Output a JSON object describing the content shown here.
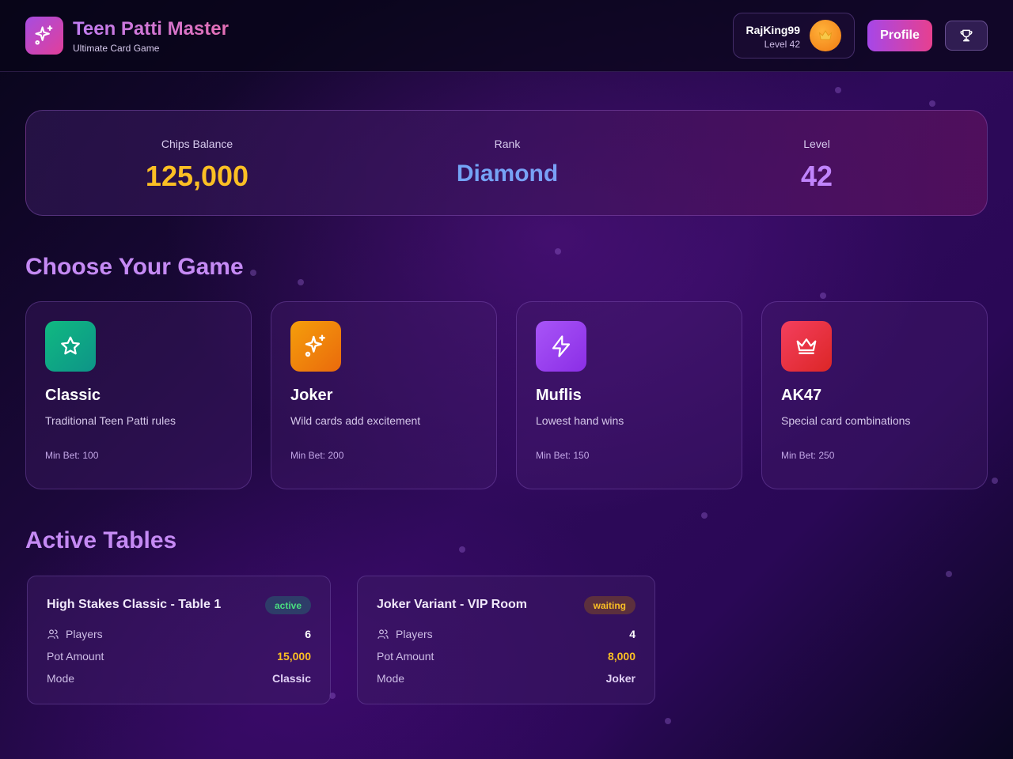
{
  "header": {
    "app_title": "Teen Patti Master",
    "app_subtitle": "Ultimate Card Game",
    "logo_icon": "sparkles-icon",
    "user": {
      "name": "RajKing99",
      "level": "Level 42",
      "avatar_icon": "crown-icon"
    },
    "profile_label": "Profile",
    "trophy_icon": "trophy-icon"
  },
  "stats": {
    "chips": {
      "label": "Chips Balance",
      "value": "125,000"
    },
    "rank": {
      "label": "Rank",
      "value": "Diamond"
    },
    "level": {
      "label": "Level",
      "value": "42"
    }
  },
  "games_section": {
    "title": "Choose Your Game",
    "games": [
      {
        "name": "Classic",
        "description": "Traditional Teen Patti rules",
        "min_bet": "Min Bet: 100",
        "icon": "star-icon",
        "color": "#10b981"
      },
      {
        "name": "Joker",
        "description": "Wild cards add excitement",
        "min_bet": "Min Bet: 200",
        "icon": "sparkles-icon",
        "color": "#f59e0b"
      },
      {
        "name": "Muflis",
        "description": "Lowest hand wins",
        "min_bet": "Min Bet: 150",
        "icon": "lightning-icon",
        "color": "#a855f7"
      },
      {
        "name": "AK47",
        "description": "Special card combinations",
        "min_bet": "Min Bet: 250",
        "icon": "crown-icon",
        "color": "#e11d48"
      }
    ]
  },
  "tables_section": {
    "title": "Active Tables",
    "tables": [
      {
        "title": "High Stakes Classic - Table 1",
        "status": "active",
        "players_label": "Players",
        "players": "6",
        "pot_label": "Pot Amount",
        "pot": "15,000",
        "mode_label": "Mode",
        "mode": "Classic"
      },
      {
        "title": "Joker Variant - VIP Room",
        "status": "waiting",
        "players_label": "Players",
        "players": "4",
        "pot_label": "Pot Amount",
        "pot": "8,000",
        "mode_label": "Mode",
        "mode": "Joker"
      }
    ]
  }
}
